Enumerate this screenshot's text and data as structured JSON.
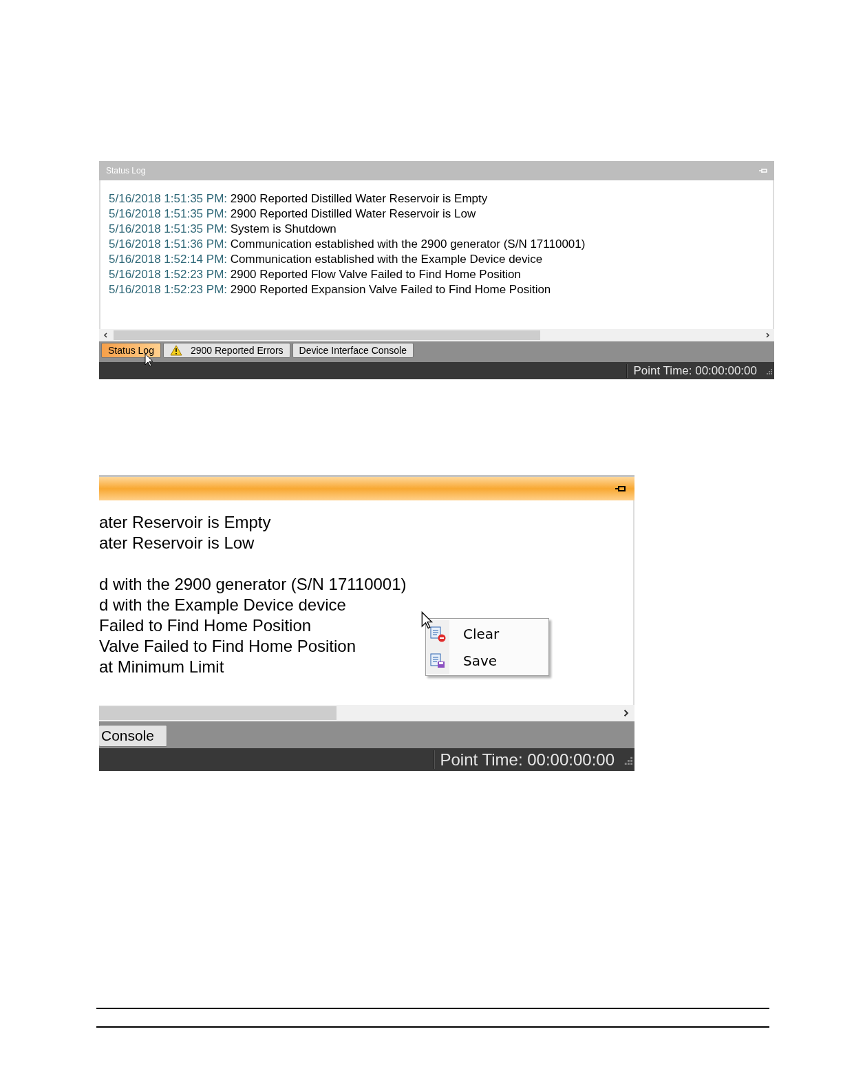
{
  "status_log_panel": {
    "title": "Status Log",
    "title_active": false,
    "log": [
      {
        "time": "5/16/2018 1:51:35 PM:",
        "message": "2900 Reported Distilled Water Reservoir is Empty"
      },
      {
        "time": "5/16/2018 1:51:35 PM:",
        "message": "2900 Reported Distilled Water Reservoir is Low"
      },
      {
        "time": "5/16/2018 1:51:35 PM:",
        "message": "System is Shutdown"
      },
      {
        "time": "5/16/2018 1:51:36 PM:",
        "message": "Communication established with the 2900 generator (S/N 17110001)"
      },
      {
        "time": "5/16/2018 1:52:14 PM:",
        "message": "Communication established with the Example Device device"
      },
      {
        "time": "5/16/2018 1:52:23 PM:",
        "message": "2900 Reported Flow Valve Failed to Find Home Position"
      },
      {
        "time": "5/16/2018 1:52:23 PM:",
        "message": "2900 Reported Expansion Valve Failed to Find Home Position"
      }
    ],
    "tabs": [
      {
        "label": "Status Log",
        "selected": true,
        "warning": false
      },
      {
        "label": "2900 Reported Errors",
        "selected": false,
        "warning": true
      },
      {
        "label": "Device Interface Console",
        "selected": false,
        "warning": false
      }
    ],
    "status": "Point Time: 00:00:00:00"
  },
  "zoomed_panel": {
    "title_active": true,
    "line_groups": [
      [
        "ater Reservoir is Empty",
        "ater Reservoir is Low"
      ],
      [
        "d with the 2900 generator (S/N 17110001)",
        "d with the Example Device device",
        "Failed to Find Home Position",
        "Valve Failed to Find Home Position",
        "at Minimum Limit"
      ]
    ],
    "tabs": [
      {
        "label": "Console",
        "selected": false,
        "warning": false
      }
    ],
    "status": "Point Time: 00:00:00:00",
    "context_menu": [
      {
        "kind": "clear",
        "label": "Clear"
      },
      {
        "kind": "save",
        "label": "Save"
      }
    ]
  }
}
